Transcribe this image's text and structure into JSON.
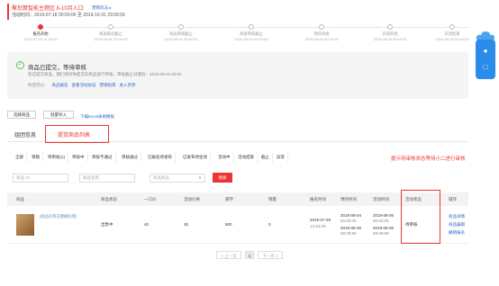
{
  "header": {
    "title": "聚划算智能主题区 8-10月入口",
    "tag": "营销玩法 ▸",
    "time_label": "活动时间：",
    "time_value": "2019-07-18 00:00:00 至 2019-10-31 23:59:59"
  },
  "timeline": [
    {
      "label": "报名开始",
      "date": "2019-07-29 14:35:20",
      "active": true
    },
    {
      "label": "商家报名截止",
      "date": "2019-08-01 00:00:00",
      "active": false
    },
    {
      "label": "商品审核截止",
      "date": "2019-08-01 00:00:00",
      "active": false
    },
    {
      "label": "商家审核截止",
      "date": "2019-08-04 00:00:00",
      "active": false
    },
    {
      "label": "预热开始",
      "date": "2019-08-05 00:00:00",
      "active": false
    },
    {
      "label": "开团开始",
      "date": "2019-08-06 00:00:00",
      "active": false
    },
    {
      "label": "开团结束",
      "date": "2019-08-08 00:00:00",
      "active": false
    }
  ],
  "status": {
    "title": "商品已提交，等待审核",
    "desc": "您已提交商品，我们将对你提交的商品进行审核，审核截止日期为：2019-08-04 00:00",
    "prefix": "你还可以：",
    "links": [
      "商品报名",
      "查看活动协议",
      "营销指南",
      "进入奖券"
    ]
  },
  "actions": {
    "select_goods": "选择商品",
    "batch_import": "批量导入",
    "download": "下载Excel表格模板"
  },
  "tabs": {
    "info": "组团信息",
    "goods_list": "提货商品列表"
  },
  "filters": [
    "全部",
    "草稿",
    "待审核(1)",
    "审核中",
    "审核不通过",
    "审核通过",
    "已报名待发布",
    "已发布待生效",
    "活动中",
    "活动结束",
    "截止",
    "异常"
  ],
  "filter_hint": "提示待审核状态等待小二进行审核",
  "search": {
    "goods_id_placeholder": "商品 ID",
    "goods_name_placeholder": "商品名称",
    "status_placeholder": "商品状态",
    "button": "搜索"
  },
  "table": {
    "headers": [
      "商品",
      "商品状态",
      "一口价",
      "活动价格",
      "库存",
      "销量",
      "报名时间",
      "预热时间",
      "活动时间",
      "活动状态",
      "操作"
    ],
    "row": {
      "name": "[商品名称已模糊处理]",
      "status": "出售中",
      "price": "40",
      "activity_price": "30",
      "stock": "800",
      "sales": "0",
      "signup_date": "2019-07-29",
      "signup_time": "14:34:25",
      "warmup_start": "2019-08-04",
      "warmup_start_time": "00:00:00",
      "warmup_end": "2019-08-05",
      "warmup_end_time": "08:09:59",
      "activity_start": "2019-08-05",
      "activity_start_time": "00:00:00",
      "activity_end": "2019-08-06",
      "activity_end_time": "08:09:59",
      "activity_status": "待审核",
      "ops": [
        "商品详情",
        "商品编辑",
        "撤销报名"
      ]
    }
  },
  "pager": {
    "prev": "< 上一页",
    "current": "1",
    "next": "下一页 >"
  },
  "colors": {
    "accent": "#e33333",
    "link": "#2d6bc4",
    "float": "#2a8ce8"
  }
}
